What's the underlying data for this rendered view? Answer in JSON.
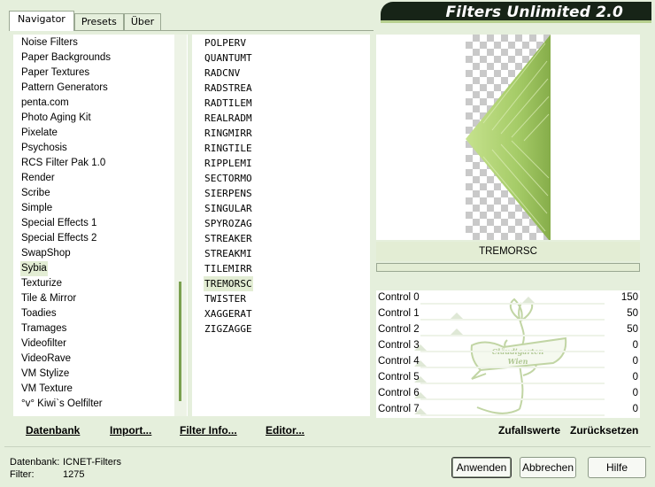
{
  "tabs": [
    {
      "label": "Navigator",
      "active": true
    },
    {
      "label": "Presets",
      "active": false
    },
    {
      "label": "Über",
      "active": false
    }
  ],
  "banner": {
    "title": "Filters Unlimited 2.0"
  },
  "categories": {
    "items": [
      "Noise Filters",
      "Paper Backgrounds",
      "Paper Textures",
      "Pattern Generators",
      "penta.com",
      "Photo Aging Kit",
      "Pixelate",
      "Psychosis",
      "RCS Filter Pak 1.0",
      "Render",
      "Scribe",
      "Simple",
      "Special Effects 1",
      "Special Effects 2",
      "SwapShop",
      "Sybia",
      "Texturize",
      "Tile & Mirror",
      "Toadies",
      "Tramages",
      "Videofilter",
      "VideoRave",
      "VM Stylize",
      "VM Texture",
      "°v° Kiwi`s Oelfilter"
    ],
    "selected_index": 15
  },
  "filters": {
    "items": [
      "POLPERV",
      "QUANTUMT",
      "RADCNV",
      "RADSTREA",
      "RADTILEM",
      "REALRADM",
      "RINGMIRR",
      "RINGTILE",
      "RIPPLEMI",
      "SECTORMO",
      "SIERPENS",
      "SINGULAR",
      "SPYROZAG",
      "STREAKER",
      "STREAKMI",
      "TILEMIRR",
      "TREMORSC",
      "TWISTER",
      "XAGGERAT",
      "ZIGZAGGE"
    ],
    "selected_index": 16
  },
  "list_buttons": {
    "database": "Datenbank",
    "import": "Import...",
    "filter_info": "Filter Info...",
    "editor": "Editor..."
  },
  "preview": {
    "filter_name": "TREMORSC",
    "progress": 0
  },
  "controls": [
    {
      "label": "Control 0",
      "value": "150"
    },
    {
      "label": "Control 1",
      "value": "50"
    },
    {
      "label": "Control 2",
      "value": "50"
    },
    {
      "label": "Control 3",
      "value": "0"
    },
    {
      "label": "Control 4",
      "value": "0"
    },
    {
      "label": "Control 5",
      "value": "0"
    },
    {
      "label": "Control 6",
      "value": "0"
    },
    {
      "label": "Control 7",
      "value": "0"
    }
  ],
  "control_buttons": {
    "random": "Zufallswerte",
    "reset": "Zurücksetzen"
  },
  "watermark_text": {
    "line1": "Cläudigarten",
    "line2": "Wien"
  },
  "status": {
    "database_label": "Datenbank:",
    "database_value": "ICNET-Filters",
    "filter_label": "Filter:",
    "filter_value": "1275"
  },
  "dialog_buttons": {
    "apply": "Anwenden",
    "cancel": "Abbrechen",
    "help": "Hilfe"
  },
  "colors": {
    "window_bg": "#e5efdc",
    "accent": "#7aa050",
    "banner": "#172417",
    "selection": "#e3edd4"
  }
}
